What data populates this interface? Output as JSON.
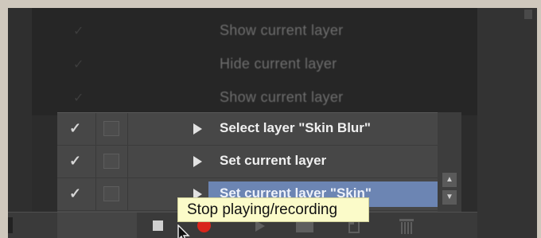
{
  "dim_rows": [
    {
      "check": "✓",
      "label": "Show current layer"
    },
    {
      "check": "✓",
      "label": "Hide current layer"
    },
    {
      "check": "✓",
      "label": "Show current layer"
    }
  ],
  "action_rows": [
    {
      "check": "✓",
      "label": "Select layer \"Skin Blur\"",
      "selected": false
    },
    {
      "check": "✓",
      "label": "Set current layer",
      "selected": false
    },
    {
      "check": "✓",
      "label": "Set current layer \"Skin\"",
      "selected": true
    }
  ],
  "scrollbar": {
    "up": "▲",
    "down": "▼"
  },
  "toolbar": {
    "buttons": [
      {
        "name": "stop-button",
        "icon": "stop-square-icon"
      },
      {
        "name": "record-button",
        "icon": "record-dot-icon",
        "color": "#d9261c"
      },
      {
        "name": "play-button",
        "icon": "play-triangle-icon"
      },
      {
        "name": "new-set-button",
        "icon": "folder-icon"
      },
      {
        "name": "new-action-button",
        "icon": "new-page-icon"
      },
      {
        "name": "delete-button",
        "icon": "trash-icon"
      }
    ]
  },
  "tooltip": {
    "text": "Stop playing/recording"
  },
  "colors": {
    "selection": "#6c85b3",
    "record": "#d9261c",
    "tooltip_bg": "#fbfbc9"
  }
}
